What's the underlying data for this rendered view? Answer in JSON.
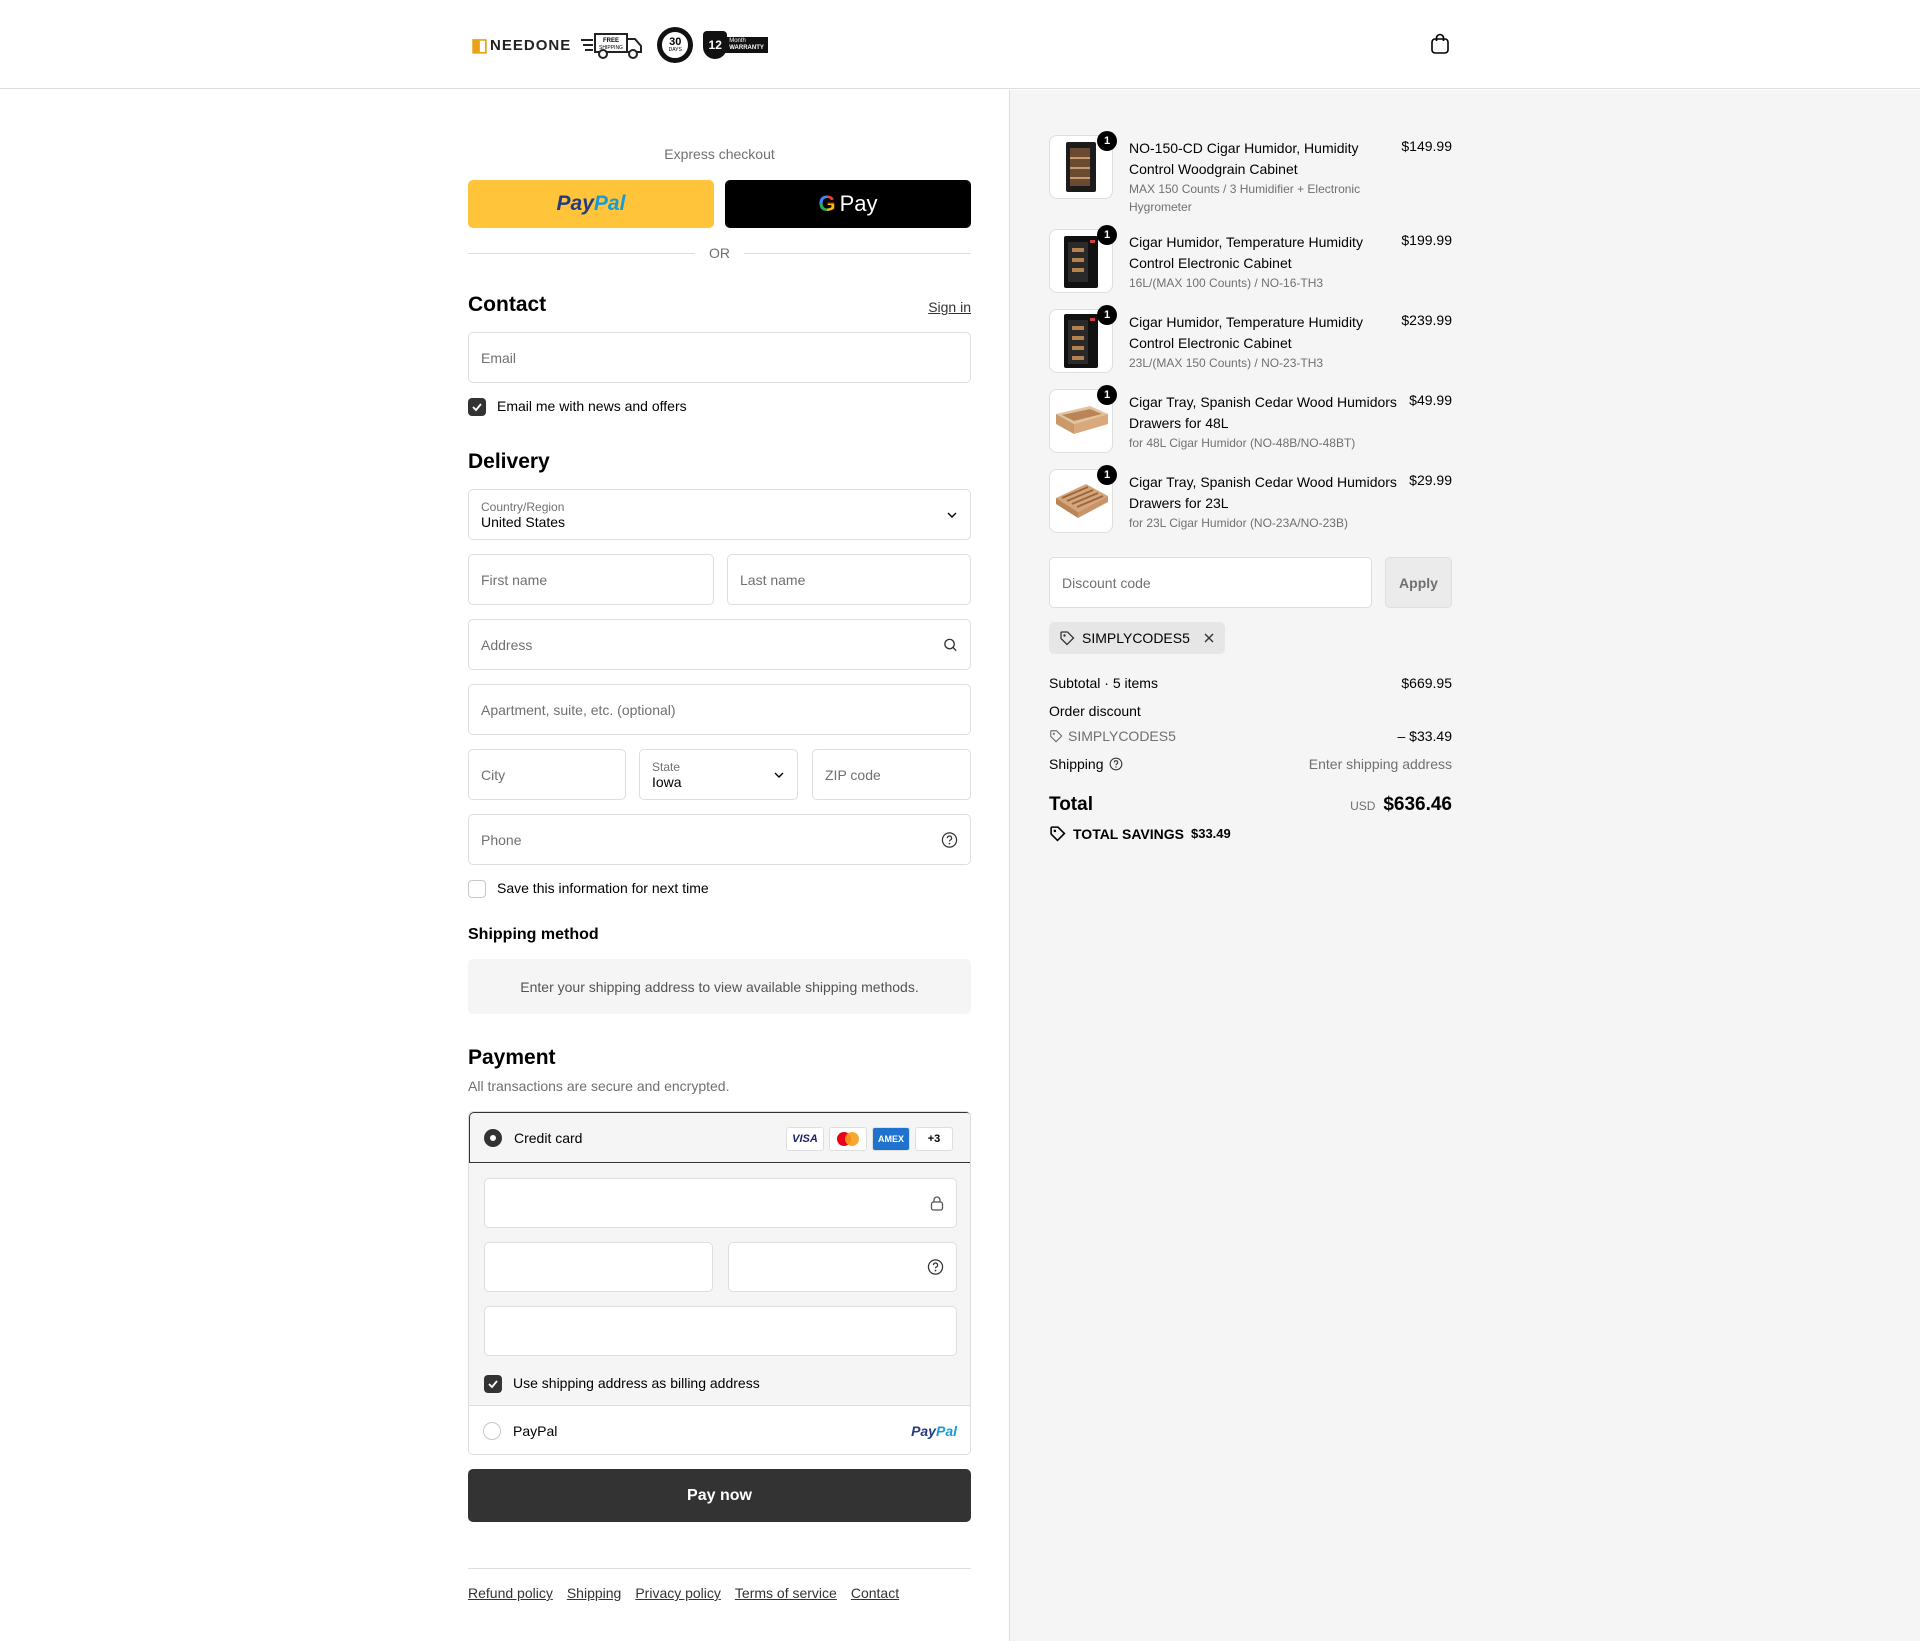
{
  "header": {
    "brand": "NEEDONE",
    "badge_free_shipping": "FREE SHIPPING",
    "badge_days_number": "30",
    "badge_days_label": "DAYS",
    "badge_warranty_number": "12",
    "badge_warranty_label": "WARRANTY",
    "badge_warranty_month": "Month"
  },
  "express": {
    "title": "Express checkout",
    "paypal_pay": "Pay",
    "paypal_pal": "Pal",
    "gpay_label": "Pay",
    "or_label": "OR"
  },
  "contact": {
    "title": "Contact",
    "sign_in": "Sign in",
    "email_placeholder": "Email",
    "news_label": "Email me with news and offers"
  },
  "delivery": {
    "title": "Delivery",
    "country_label": "Country/Region",
    "country_value": "United States",
    "first_name": "First name",
    "last_name": "Last name",
    "address": "Address",
    "apartment": "Apartment, suite, etc. (optional)",
    "city": "City",
    "state_label": "State",
    "state_value": "Iowa",
    "zip": "ZIP code",
    "phone": "Phone",
    "save_info": "Save this information for next time"
  },
  "shipping_method": {
    "title": "Shipping method",
    "message": "Enter your shipping address to view available shipping methods."
  },
  "payment": {
    "title": "Payment",
    "subtitle": "All transactions are secure and encrypted.",
    "credit_card": "Credit card",
    "card_visa": "VISA",
    "card_amex": "AMEX",
    "card_more": "+3",
    "billing_label": "Use shipping address as billing address",
    "paypal_option": "PayPal",
    "paypal_logo_pay": "Pay",
    "paypal_logo_pal": "Pal",
    "pay_now": "Pay now"
  },
  "footer": {
    "links": [
      "Refund policy",
      "Shipping",
      "Privacy policy",
      "Terms of service",
      "Contact"
    ]
  },
  "summary": {
    "items": [
      {
        "qty": "1",
        "name": "NO-150-CD Cigar Humidor, Humidity Control Woodgrain Cabinet",
        "variant": "MAX 150 Counts / 3 Humidifier + Electronic Hygrometer",
        "price": "$149.99"
      },
      {
        "qty": "1",
        "name": "Cigar Humidor, Temperature Humidity Control Electronic Cabinet",
        "variant": "16L/(MAX 100 Counts) / NO-16-TH3",
        "price": "$199.99"
      },
      {
        "qty": "1",
        "name": "Cigar Humidor, Temperature Humidity Control Electronic Cabinet",
        "variant": "23L/(MAX 150 Counts) / NO-23-TH3",
        "price": "$239.99"
      },
      {
        "qty": "1",
        "name": "Cigar Tray, Spanish Cedar Wood Humidors Drawers for 48L",
        "variant": "for 48L Cigar Humidor (NO-48B/NO-48BT)",
        "price": "$49.99"
      },
      {
        "qty": "1",
        "name": "Cigar Tray, Spanish Cedar Wood Humidors Drawers for 23L",
        "variant": "for 23L Cigar Humidor (NO-23A/NO-23B)",
        "price": "$29.99"
      }
    ],
    "discount_placeholder": "Discount code",
    "apply": "Apply",
    "applied_code": "SIMPLYCODES5",
    "subtotal_label": "Subtotal · 5 items",
    "subtotal_value": "$669.95",
    "order_discount_label": "Order discount",
    "discount_code": "SIMPLYCODES5",
    "discount_value": "– $33.49",
    "shipping_label": "Shipping",
    "shipping_value": "Enter shipping address",
    "total_label": "Total",
    "currency": "USD",
    "total_value": "$636.46",
    "savings_label": "TOTAL SAVINGS",
    "savings_value": "$33.49"
  }
}
